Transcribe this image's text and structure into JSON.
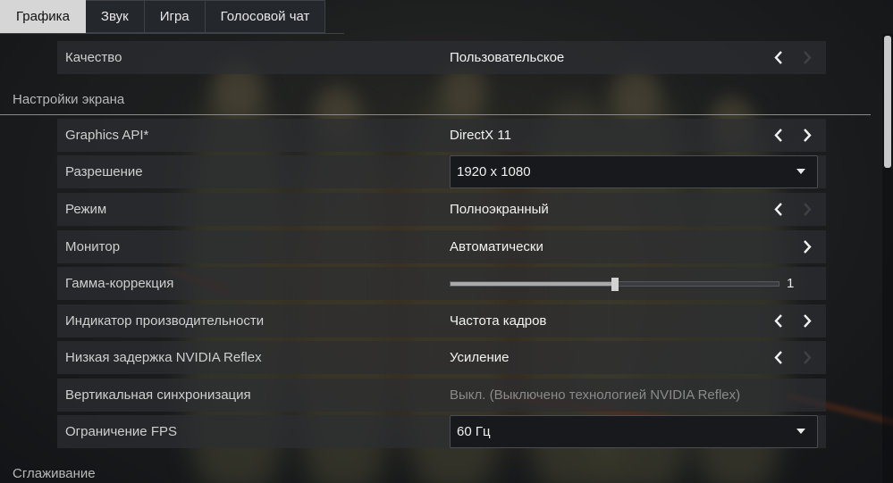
{
  "tabs": [
    {
      "label": "Графика",
      "active": true
    },
    {
      "label": "Звук",
      "active": false
    },
    {
      "label": "Игра",
      "active": false
    },
    {
      "label": "Голосовой чат",
      "active": false
    }
  ],
  "quality": {
    "label": "Качество",
    "value": "Пользовательское"
  },
  "sections": {
    "screen": "Настройки экрана",
    "antialiasing": "Сглаживание"
  },
  "settings": {
    "graphics_api": {
      "label": "Graphics API*",
      "value": "DirectX 11"
    },
    "resolution": {
      "label": "Разрешение",
      "value": "1920 x 1080"
    },
    "mode": {
      "label": "Режим",
      "value": "Полноэкранный"
    },
    "monitor": {
      "label": "Монитор",
      "value": "Автоматически"
    },
    "gamma": {
      "label": "Гамма-коррекция",
      "value": "1",
      "level": 0.5
    },
    "performance_indicator": {
      "label": "Индикатор производительности",
      "value": "Частота кадров"
    },
    "reflex": {
      "label": "Низкая задержка NVIDIA Reflex",
      "value": "Усиление"
    },
    "vsync": {
      "label": "Вертикальная синхронизация",
      "value": "Выкл. (Выключено технологией NVIDIA Reflex)"
    },
    "fps_limit": {
      "label": "Ограничение FPS",
      "value": "60 Гц"
    }
  },
  "icons": {
    "arrow_left": "chevron-left-icon",
    "arrow_right": "chevron-right-icon",
    "dropdown": "caret-down-icon"
  },
  "colors": {
    "active_tab": "#d6d6d6",
    "row_bg": "#2c2e32",
    "disabled_text": "#8a8a8a"
  }
}
